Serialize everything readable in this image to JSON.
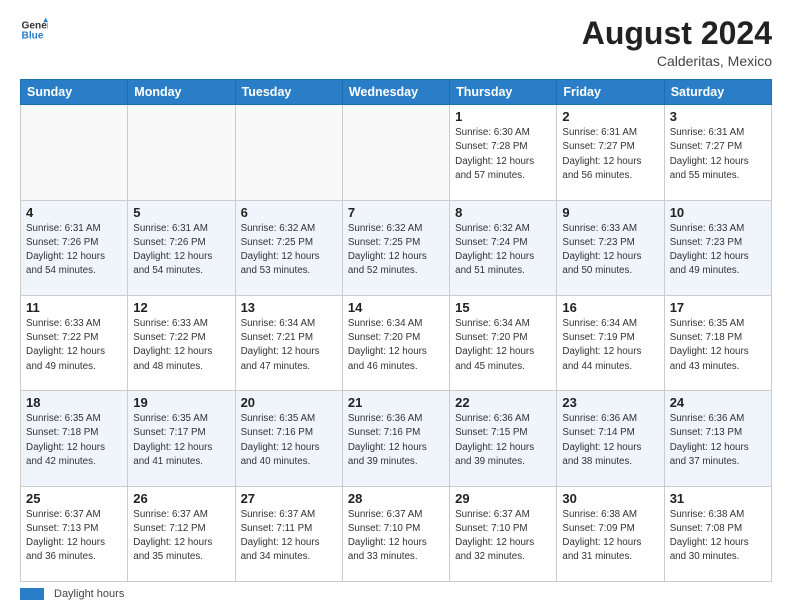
{
  "header": {
    "logo_line1": "General",
    "logo_line2": "Blue",
    "month_year": "August 2024",
    "location": "Calderitas, Mexico"
  },
  "weekdays": [
    "Sunday",
    "Monday",
    "Tuesday",
    "Wednesday",
    "Thursday",
    "Friday",
    "Saturday"
  ],
  "weeks": [
    [
      {
        "day": "",
        "info": ""
      },
      {
        "day": "",
        "info": ""
      },
      {
        "day": "",
        "info": ""
      },
      {
        "day": "",
        "info": ""
      },
      {
        "day": "1",
        "info": "Sunrise: 6:30 AM\nSunset: 7:28 PM\nDaylight: 12 hours\nand 57 minutes."
      },
      {
        "day": "2",
        "info": "Sunrise: 6:31 AM\nSunset: 7:27 PM\nDaylight: 12 hours\nand 56 minutes."
      },
      {
        "day": "3",
        "info": "Sunrise: 6:31 AM\nSunset: 7:27 PM\nDaylight: 12 hours\nand 55 minutes."
      }
    ],
    [
      {
        "day": "4",
        "info": "Sunrise: 6:31 AM\nSunset: 7:26 PM\nDaylight: 12 hours\nand 54 minutes."
      },
      {
        "day": "5",
        "info": "Sunrise: 6:31 AM\nSunset: 7:26 PM\nDaylight: 12 hours\nand 54 minutes."
      },
      {
        "day": "6",
        "info": "Sunrise: 6:32 AM\nSunset: 7:25 PM\nDaylight: 12 hours\nand 53 minutes."
      },
      {
        "day": "7",
        "info": "Sunrise: 6:32 AM\nSunset: 7:25 PM\nDaylight: 12 hours\nand 52 minutes."
      },
      {
        "day": "8",
        "info": "Sunrise: 6:32 AM\nSunset: 7:24 PM\nDaylight: 12 hours\nand 51 minutes."
      },
      {
        "day": "9",
        "info": "Sunrise: 6:33 AM\nSunset: 7:23 PM\nDaylight: 12 hours\nand 50 minutes."
      },
      {
        "day": "10",
        "info": "Sunrise: 6:33 AM\nSunset: 7:23 PM\nDaylight: 12 hours\nand 49 minutes."
      }
    ],
    [
      {
        "day": "11",
        "info": "Sunrise: 6:33 AM\nSunset: 7:22 PM\nDaylight: 12 hours\nand 49 minutes."
      },
      {
        "day": "12",
        "info": "Sunrise: 6:33 AM\nSunset: 7:22 PM\nDaylight: 12 hours\nand 48 minutes."
      },
      {
        "day": "13",
        "info": "Sunrise: 6:34 AM\nSunset: 7:21 PM\nDaylight: 12 hours\nand 47 minutes."
      },
      {
        "day": "14",
        "info": "Sunrise: 6:34 AM\nSunset: 7:20 PM\nDaylight: 12 hours\nand 46 minutes."
      },
      {
        "day": "15",
        "info": "Sunrise: 6:34 AM\nSunset: 7:20 PM\nDaylight: 12 hours\nand 45 minutes."
      },
      {
        "day": "16",
        "info": "Sunrise: 6:34 AM\nSunset: 7:19 PM\nDaylight: 12 hours\nand 44 minutes."
      },
      {
        "day": "17",
        "info": "Sunrise: 6:35 AM\nSunset: 7:18 PM\nDaylight: 12 hours\nand 43 minutes."
      }
    ],
    [
      {
        "day": "18",
        "info": "Sunrise: 6:35 AM\nSunset: 7:18 PM\nDaylight: 12 hours\nand 42 minutes."
      },
      {
        "day": "19",
        "info": "Sunrise: 6:35 AM\nSunset: 7:17 PM\nDaylight: 12 hours\nand 41 minutes."
      },
      {
        "day": "20",
        "info": "Sunrise: 6:35 AM\nSunset: 7:16 PM\nDaylight: 12 hours\nand 40 minutes."
      },
      {
        "day": "21",
        "info": "Sunrise: 6:36 AM\nSunset: 7:16 PM\nDaylight: 12 hours\nand 39 minutes."
      },
      {
        "day": "22",
        "info": "Sunrise: 6:36 AM\nSunset: 7:15 PM\nDaylight: 12 hours\nand 39 minutes."
      },
      {
        "day": "23",
        "info": "Sunrise: 6:36 AM\nSunset: 7:14 PM\nDaylight: 12 hours\nand 38 minutes."
      },
      {
        "day": "24",
        "info": "Sunrise: 6:36 AM\nSunset: 7:13 PM\nDaylight: 12 hours\nand 37 minutes."
      }
    ],
    [
      {
        "day": "25",
        "info": "Sunrise: 6:37 AM\nSunset: 7:13 PM\nDaylight: 12 hours\nand 36 minutes."
      },
      {
        "day": "26",
        "info": "Sunrise: 6:37 AM\nSunset: 7:12 PM\nDaylight: 12 hours\nand 35 minutes."
      },
      {
        "day": "27",
        "info": "Sunrise: 6:37 AM\nSunset: 7:11 PM\nDaylight: 12 hours\nand 34 minutes."
      },
      {
        "day": "28",
        "info": "Sunrise: 6:37 AM\nSunset: 7:10 PM\nDaylight: 12 hours\nand 33 minutes."
      },
      {
        "day": "29",
        "info": "Sunrise: 6:37 AM\nSunset: 7:10 PM\nDaylight: 12 hours\nand 32 minutes."
      },
      {
        "day": "30",
        "info": "Sunrise: 6:38 AM\nSunset: 7:09 PM\nDaylight: 12 hours\nand 31 minutes."
      },
      {
        "day": "31",
        "info": "Sunrise: 6:38 AM\nSunset: 7:08 PM\nDaylight: 12 hours\nand 30 minutes."
      }
    ]
  ],
  "footer": {
    "legend_label": "Daylight hours"
  }
}
